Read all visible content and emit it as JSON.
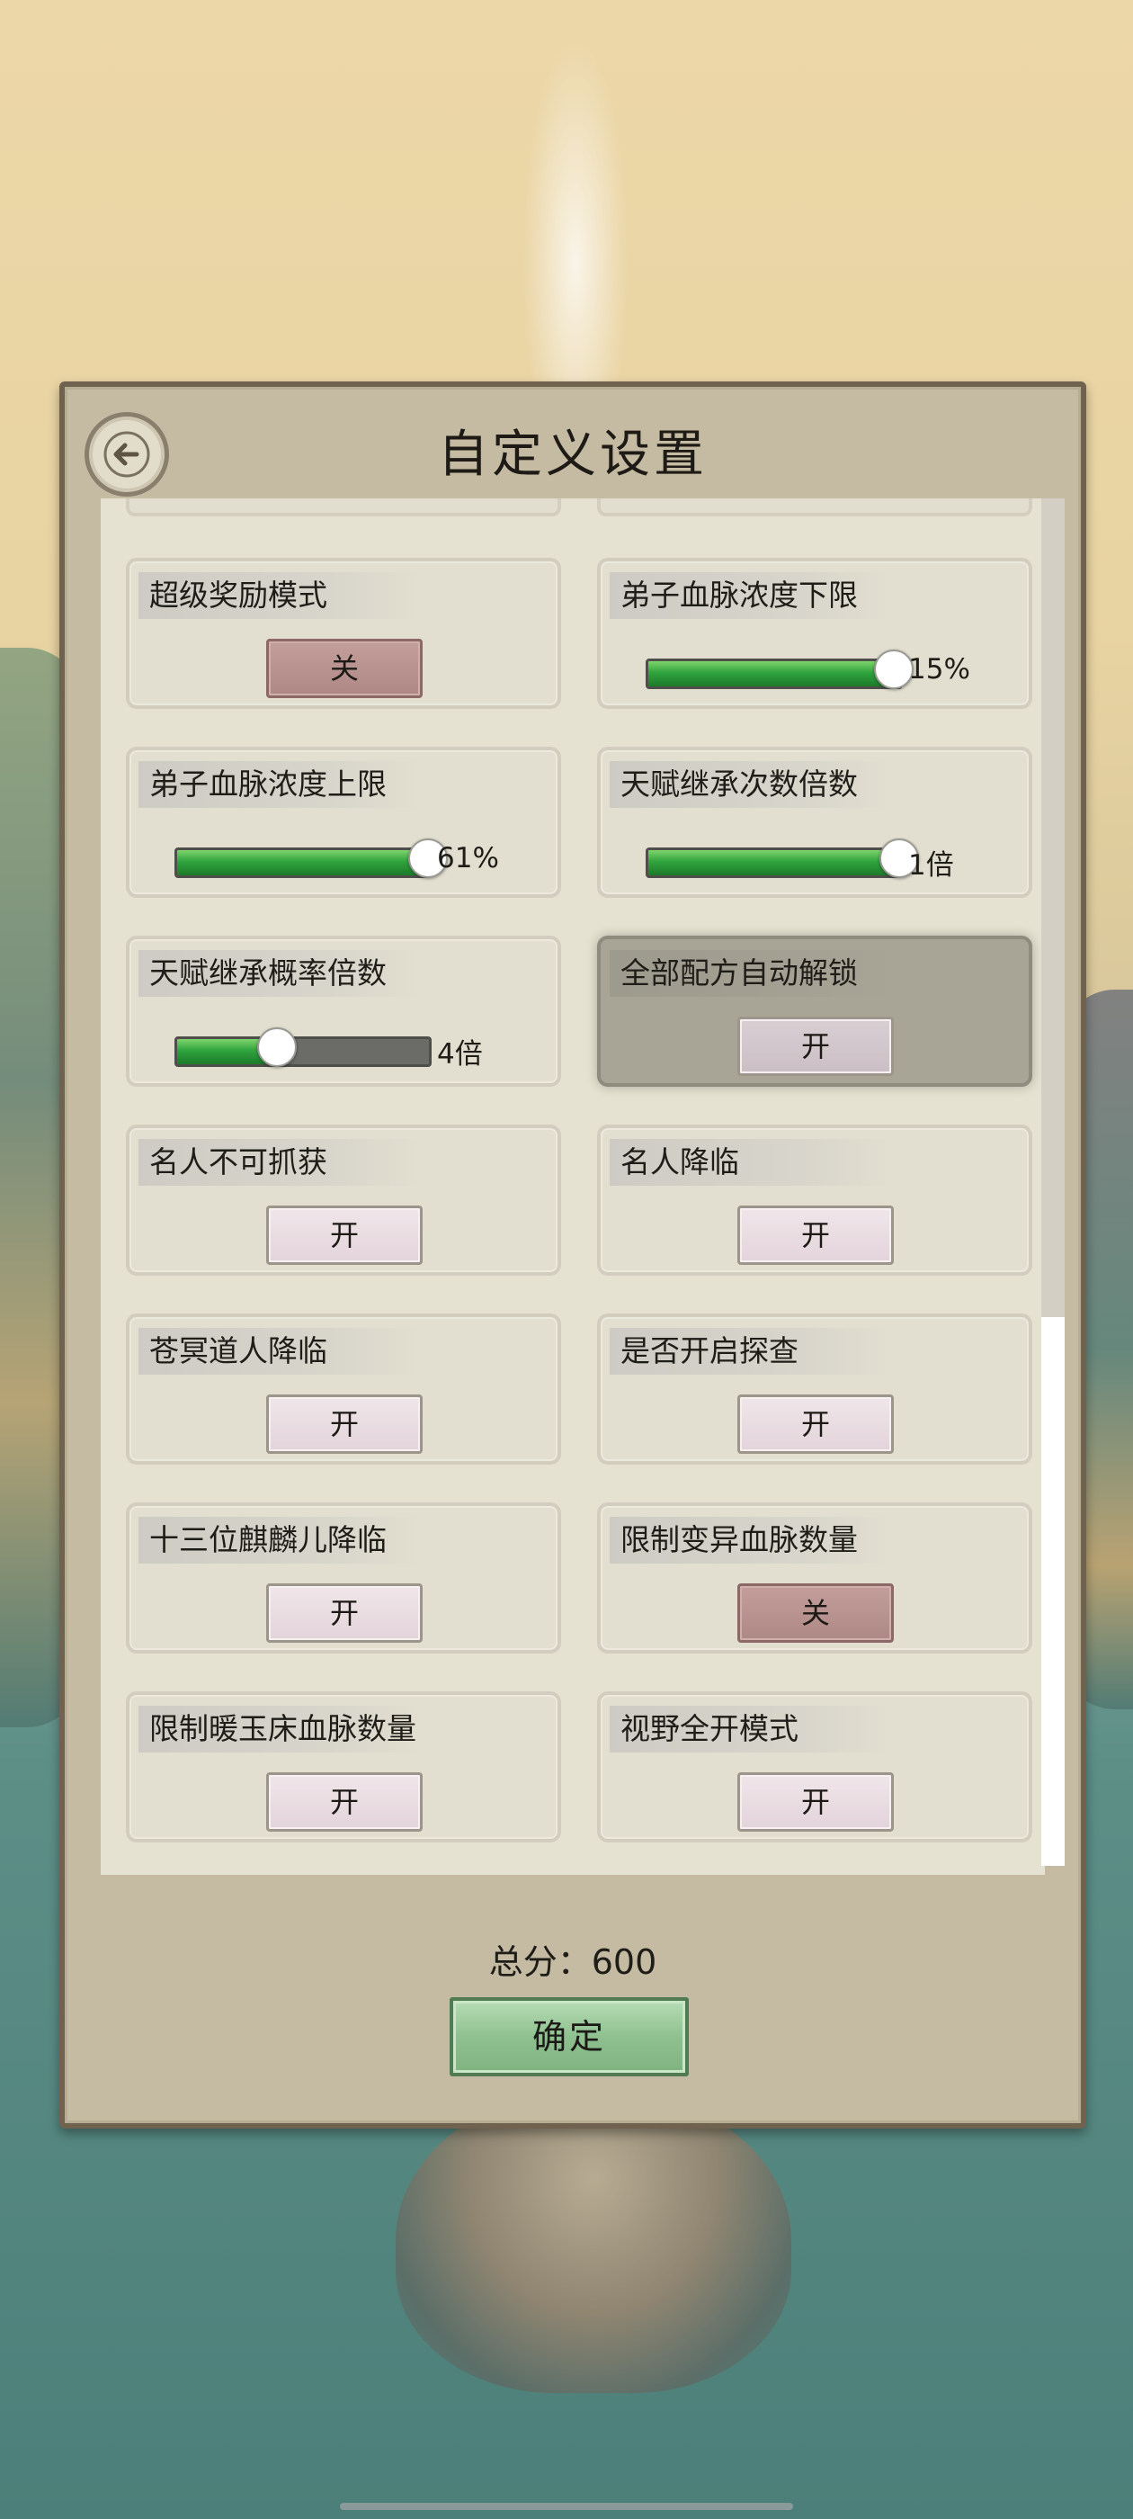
{
  "dialog": {
    "title": "自定义设置",
    "score_text": "总分：600",
    "confirm_label": "确定"
  },
  "settings": [
    {
      "id": "super-reward-mode",
      "label": "超级奖励模式",
      "type": "toggle",
      "value": "关",
      "state": "off"
    },
    {
      "id": "disciple-bloodline-min",
      "label": "弟子血脉浓度下限",
      "type": "slider",
      "fraction": 0.98,
      "value": "15%"
    },
    {
      "id": "disciple-bloodline-max",
      "label": "弟子血脉浓度上限",
      "type": "slider",
      "fraction": 1.0,
      "value": "61%"
    },
    {
      "id": "talent-inherit-count-multiplier",
      "label": "天赋继承次数倍数",
      "type": "slider",
      "fraction": 1.0,
      "value": "1倍"
    },
    {
      "id": "talent-inherit-prob-multiplier",
      "label": "天赋继承概率倍数",
      "type": "slider",
      "fraction": 0.4,
      "value": "4倍"
    },
    {
      "id": "all-recipes-auto-unlock",
      "label": "全部配方自动解锁",
      "type": "toggle",
      "value": "开",
      "state": "on",
      "highlighted": true
    },
    {
      "id": "celebrity-uncatchable",
      "label": "名人不可抓获",
      "type": "toggle",
      "value": "开",
      "state": "on"
    },
    {
      "id": "celebrity-arrival",
      "label": "名人降临",
      "type": "toggle",
      "value": "开",
      "state": "on"
    },
    {
      "id": "cangming-taoist-arrival",
      "label": "苍冥道人降临",
      "type": "toggle",
      "value": "开",
      "state": "on"
    },
    {
      "id": "enable-exploration",
      "label": "是否开启探查",
      "type": "toggle",
      "value": "开",
      "state": "on"
    },
    {
      "id": "thirteen-qilin-arrival",
      "label": "十三位麒麟儿降临",
      "type": "toggle",
      "value": "开",
      "state": "on"
    },
    {
      "id": "limit-mutant-bloodline",
      "label": "限制变异血脉数量",
      "type": "toggle",
      "value": "关",
      "state": "off"
    },
    {
      "id": "limit-warm-jade-bed-bloodline",
      "label": "限制暖玉床血脉数量",
      "type": "toggle",
      "value": "开",
      "state": "on"
    },
    {
      "id": "full-vision-mode",
      "label": "视野全开模式",
      "type": "toggle",
      "value": "开",
      "state": "on"
    }
  ],
  "colors": {
    "toggle_on": "#e9dde2",
    "toggle_off": "#b8928f",
    "slider_fill": "#2fa43e",
    "confirm": "#8fc190"
  }
}
